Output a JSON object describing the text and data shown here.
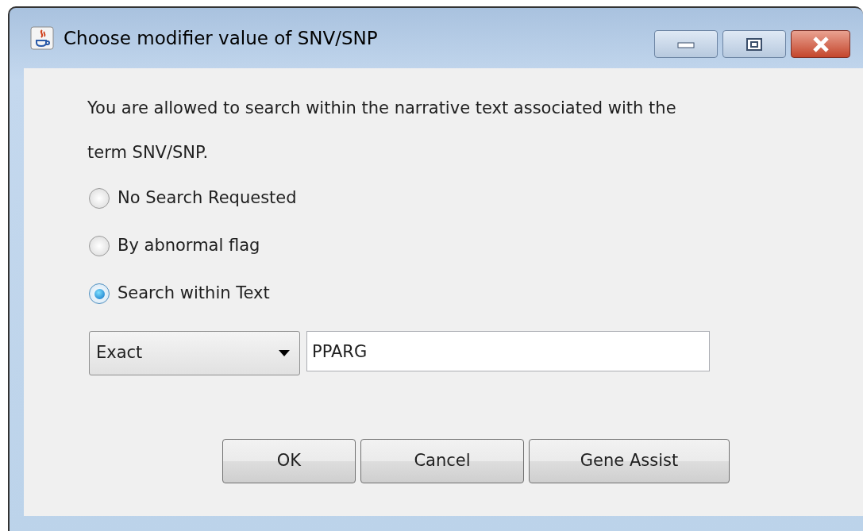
{
  "window": {
    "title": "Choose modifier value of SNV/SNP"
  },
  "message": "You are allowed to search within the narrative text associated with the term SNV/SNP.",
  "options": [
    {
      "label": "No Search Requested",
      "selected": false
    },
    {
      "label": "By abnormal flag",
      "selected": false
    },
    {
      "label": "Search within Text",
      "selected": true
    }
  ],
  "match_mode": {
    "value": "Exact"
  },
  "search_field": {
    "value": "PPARG"
  },
  "buttons": [
    "OK",
    "Cancel",
    "Gene Assist"
  ]
}
